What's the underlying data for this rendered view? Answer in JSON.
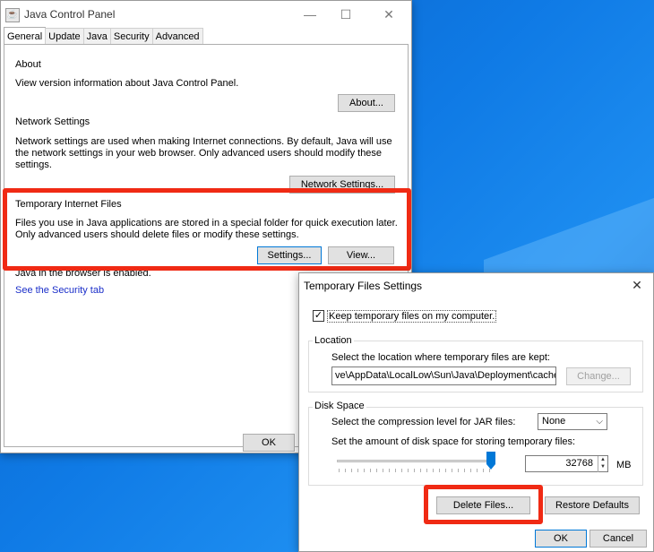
{
  "jcp": {
    "title": "Java Control Panel",
    "tabs": [
      "General",
      "Update",
      "Java",
      "Security",
      "Advanced"
    ],
    "about": {
      "heading": "About",
      "text": "View version information about Java Control Panel.",
      "button": "About..."
    },
    "network": {
      "heading": "Network Settings",
      "text_lines": [
        "Network settings are used when making Internet connections. By default, Java will use",
        "the network settings in your web browser. Only advanced users should modify these",
        "settings."
      ],
      "button": "Network Settings..."
    },
    "temp": {
      "heading": "Temporary Internet Files",
      "text_lines": [
        "Files you use in Java applications are stored in a special folder for quick execution later.",
        "Only advanced users should delete files or modify these settings."
      ],
      "settings_button": "Settings...",
      "view_button": "View..."
    },
    "browser_text": "Java in the browser is enabled.",
    "security_link": "See the Security tab",
    "ok_button": "OK"
  },
  "tfs": {
    "title": "Temporary Files Settings",
    "keep_label": "Keep temporary files on my computer.",
    "keep_checked": true,
    "location": {
      "heading": "Location",
      "text": "Select the location where temporary files are kept:",
      "path": "ve\\AppData\\LocalLow\\Sun\\Java\\Deployment\\cache",
      "change_button": "Change..."
    },
    "disk": {
      "heading": "Disk Space",
      "compression_label": "Select the compression level for JAR files:",
      "compression_value": "None",
      "amount_label": "Set the amount of disk space for storing temporary files:",
      "amount_value": "32768",
      "unit": "MB"
    },
    "delete_button": "Delete Files...",
    "restore_button": "Restore Defaults",
    "ok_button": "OK",
    "cancel_button": "Cancel"
  }
}
